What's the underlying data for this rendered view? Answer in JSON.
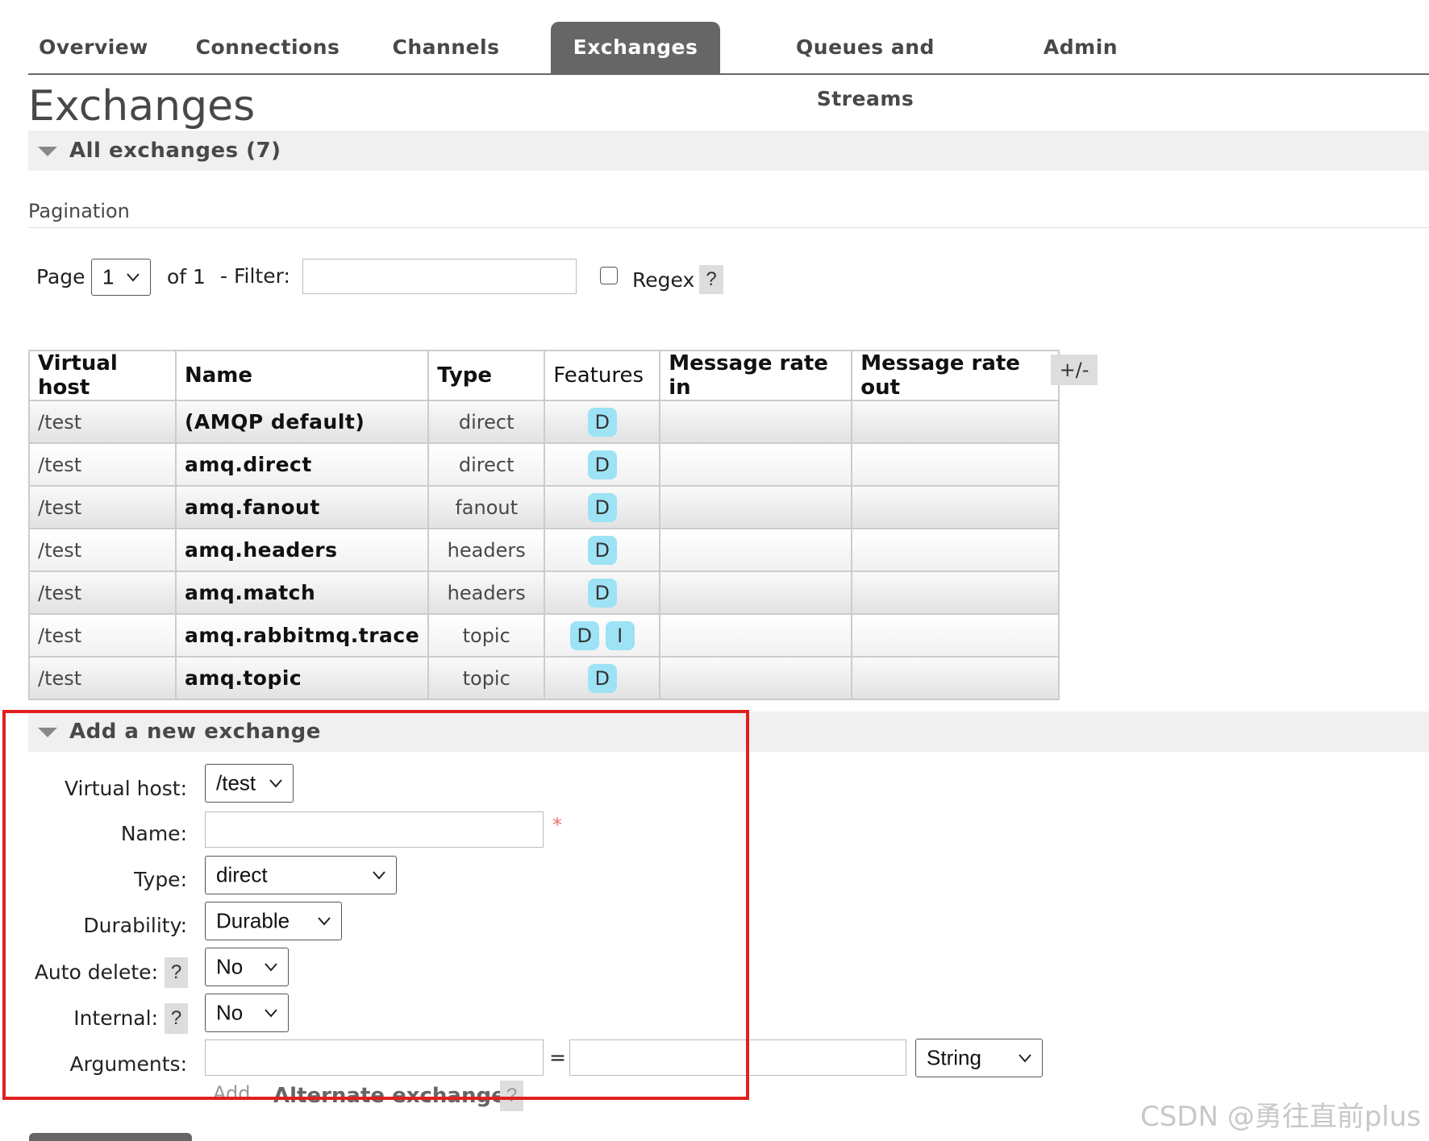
{
  "nav": {
    "tabs": [
      {
        "label": "Overview",
        "active": false
      },
      {
        "label": "Connections",
        "active": false
      },
      {
        "label": "Channels",
        "active": false
      },
      {
        "label": "Exchanges",
        "active": true
      },
      {
        "label": "Queues and Streams",
        "active": false
      },
      {
        "label": "Admin",
        "active": false
      }
    ]
  },
  "page_title": "Exchanges",
  "all_exchanges": {
    "heading": "All exchanges (7)",
    "pagination_heading": "Pagination",
    "page_label": "Page",
    "page_value": "1",
    "of_label": "of 1",
    "filter_label": "- Filter:",
    "filter_value": "",
    "regex_label": "Regex",
    "regex_checked": false,
    "help_symbol": "?"
  },
  "table": {
    "columns": [
      "Virtual host",
      "Name",
      "Type",
      "Features",
      "Message rate in",
      "Message rate out"
    ],
    "toggle_columns_label": "+/-",
    "rows": [
      {
        "vhost": "/test",
        "name": "(AMQP default)",
        "type": "direct",
        "features": [
          "D"
        ],
        "rate_in": "",
        "rate_out": ""
      },
      {
        "vhost": "/test",
        "name": "amq.direct",
        "type": "direct",
        "features": [
          "D"
        ],
        "rate_in": "",
        "rate_out": ""
      },
      {
        "vhost": "/test",
        "name": "amq.fanout",
        "type": "fanout",
        "features": [
          "D"
        ],
        "rate_in": "",
        "rate_out": ""
      },
      {
        "vhost": "/test",
        "name": "amq.headers",
        "type": "headers",
        "features": [
          "D"
        ],
        "rate_in": "",
        "rate_out": ""
      },
      {
        "vhost": "/test",
        "name": "amq.match",
        "type": "headers",
        "features": [
          "D"
        ],
        "rate_in": "",
        "rate_out": ""
      },
      {
        "vhost": "/test",
        "name": "amq.rabbitmq.trace",
        "type": "topic",
        "features": [
          "D",
          "I"
        ],
        "rate_in": "",
        "rate_out": ""
      },
      {
        "vhost": "/test",
        "name": "amq.topic",
        "type": "topic",
        "features": [
          "D"
        ],
        "rate_in": "",
        "rate_out": ""
      }
    ],
    "badge_color": "#9de3f5"
  },
  "add_exchange": {
    "heading": "Add a new exchange",
    "virtual_host_label": "Virtual host:",
    "virtual_host_value": "/test",
    "name_label": "Name:",
    "name_value": "",
    "required_mark": "*",
    "type_label": "Type:",
    "type_value": "direct",
    "durability_label": "Durability:",
    "durability_value": "Durable",
    "auto_delete_label": "Auto delete:",
    "auto_delete_value": "No",
    "internal_label": "Internal:",
    "internal_value": "No",
    "arguments_label": "Arguments:",
    "arguments_key": "",
    "equals": "=",
    "arguments_value": "",
    "arguments_type": "String",
    "add_label": "Add",
    "alternate_exchange_label": "Alternate exchange",
    "help_symbol": "?"
  },
  "highlight_color": "#e02020",
  "watermark": "CSDN @勇往直前plus"
}
